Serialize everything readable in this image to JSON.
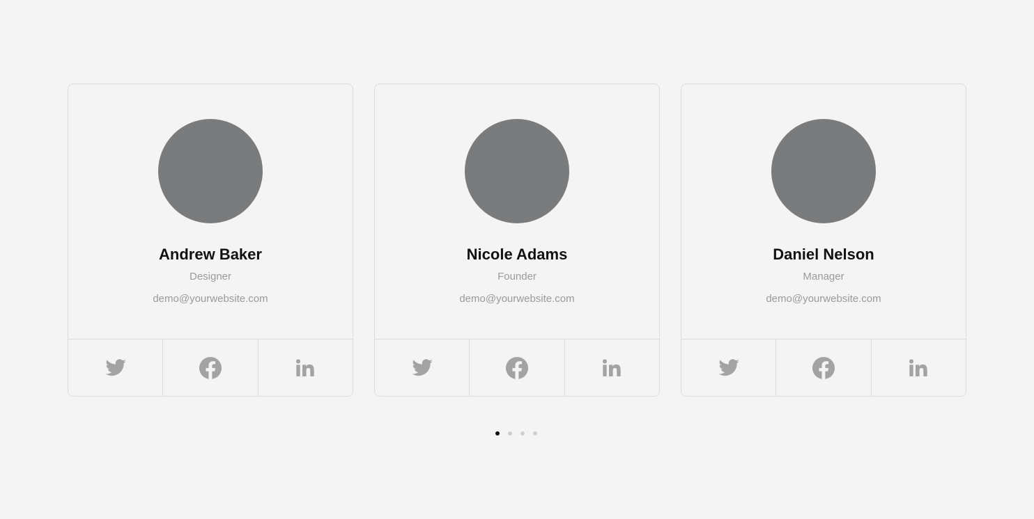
{
  "colors": {
    "page_background": "#f4f4f4",
    "avatar_placeholder": "#7a7b7c",
    "icon": "#a3a3a3",
    "dot_active": "#111111",
    "dot_inactive": "#cfcfcf"
  },
  "team": [
    {
      "name": "Andrew Baker",
      "role": "Designer",
      "email": "demo@yourwebsite.com"
    },
    {
      "name": "Nicole Adams",
      "role": "Founder",
      "email": "demo@yourwebsite.com"
    },
    {
      "name": "Daniel Nelson",
      "role": "Manager",
      "email": "demo@yourwebsite.com"
    }
  ],
  "social_icons": [
    "twitter-icon",
    "facebook-icon",
    "linkedin-icon"
  ],
  "pagination": {
    "total_pages": 4,
    "active_page": 1
  }
}
